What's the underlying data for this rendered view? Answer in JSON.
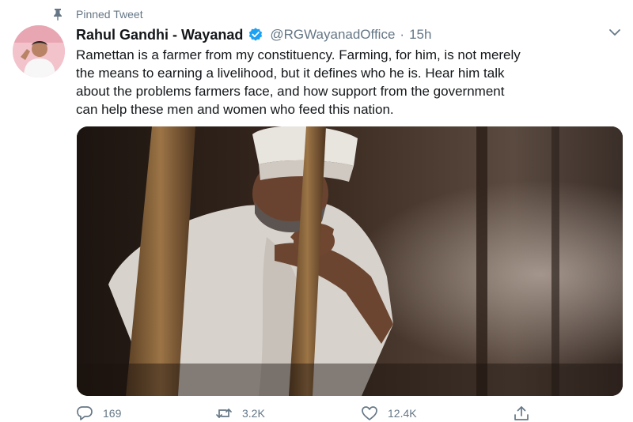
{
  "pinned": {
    "label": "Pinned Tweet",
    "icon": "pin-icon"
  },
  "author": {
    "name": "Rahul Gandhi - Wayanad",
    "verified": true,
    "handle": "@RGWayanadOffice",
    "separator": "·",
    "time": "15h"
  },
  "tweet": {
    "lines": [
      "Ramettan is a farmer from my constituency. Farming, for him, is not merely",
      "the means to earning a livelihood, but it defines who he is. Hear him talk",
      "about the problems farmers face, and how support from the government",
      "can help these men and women who feed this nation."
    ]
  },
  "actions": {
    "reply_count": "169",
    "retweet_count": "3.2K",
    "like_count": "12.4K"
  },
  "colors": {
    "accent": "#1da1f2",
    "secondary_text": "#657786",
    "primary_text": "#14171a"
  }
}
